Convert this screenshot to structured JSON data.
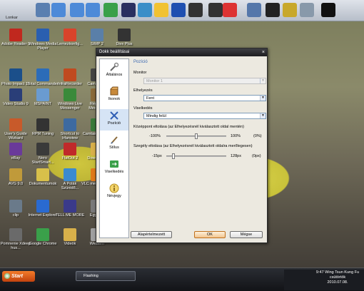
{
  "desktop": {
    "top_label": "Lonkar",
    "icons": [
      {
        "label": "Adobe Reader 9"
      },
      {
        "label": "Windows Media Player"
      },
      {
        "label": "Lemezkonfig..."
      },
      {
        "label": "SIMP 2"
      },
      {
        "label": "Divx Plus"
      },
      {
        "label": "Photo Impact 10"
      },
      {
        "label": "Total Commander"
      },
      {
        "label": "InfraRecorder"
      },
      {
        "label": "CamStudio"
      },
      {
        "label": "Video Studio 9"
      },
      {
        "label": "MSPAINT"
      },
      {
        "label": "Windows Live Messenger"
      },
      {
        "label": "Registry Mechanic"
      },
      {
        "label": "User's Guide Wizkard"
      },
      {
        "label": "RPM Tuning"
      },
      {
        "label": "Shortcut to Irfanview"
      },
      {
        "label": "Camtasia Studio"
      },
      {
        "label": "eBay"
      },
      {
        "label": "Nero StartSmart..."
      },
      {
        "label": "FlatOut 2"
      },
      {
        "label": "Downloads"
      },
      {
        "label": "AVG 9.0"
      },
      {
        "label": "Dokumentumok"
      },
      {
        "label": "A Polák Szünidő..."
      },
      {
        "label": "VLC media player"
      },
      {
        "label": "clip"
      },
      {
        "label": "Internet Explorer"
      },
      {
        "label": "TELL ME MORE"
      },
      {
        "label": "Egyéb..."
      },
      {
        "label": "Pomnenie Xdeep hus..."
      },
      {
        "label": "Google Chrome"
      },
      {
        "label": "Videók"
      },
      {
        "label": "Western"
      }
    ]
  },
  "dialog": {
    "title": "Dokk beállításai",
    "close_glyph": "×",
    "sidebar": [
      {
        "label": "Általános",
        "icon": "wrench-icon"
      },
      {
        "label": "Ikonok",
        "icon": "box-icon"
      },
      {
        "label": "Pozíció",
        "icon": "arrows-icon"
      },
      {
        "label": "Stílus",
        "icon": "brush-icon"
      },
      {
        "label": "Viselkedés",
        "icon": "behavior-icon"
      },
      {
        "label": "Névjegy",
        "icon": "info-icon"
      }
    ],
    "section_title": "Pozíció",
    "monitor_label": "Monitor",
    "monitor_value": "Monitor 1",
    "position_label": "Elhelyezés",
    "position_value": "Fent",
    "behavior_label": "Viselkedés",
    "behavior_value": "Mindig felül",
    "center_offset_label": "Középpont eltolása (az Elhelyezésnél kiválasztott oldal mentén)",
    "center_min": "-100%",
    "center_max": "100%",
    "center_value": "(0%)",
    "center_level": 0.5,
    "edge_offset_label": "Szegély eltolása (az Elhelyezésnél kiválasztott oldalra merőlegesen)",
    "edge_min": "-15px",
    "edge_max": "128px",
    "edge_value": "(0px)",
    "edge_level": 0.105,
    "btn_defaults": "Alapértelmezett",
    "btn_ok": "OK",
    "btn_cancel": "Mégse"
  },
  "taskbar": {
    "start_label": "Start",
    "task_label": "Flashing",
    "clock_time": "9:47",
    "clock_user": "Wing Tsun Kung Fu",
    "clock_day": "csütörtök",
    "clock_date": "2010.07.08."
  }
}
